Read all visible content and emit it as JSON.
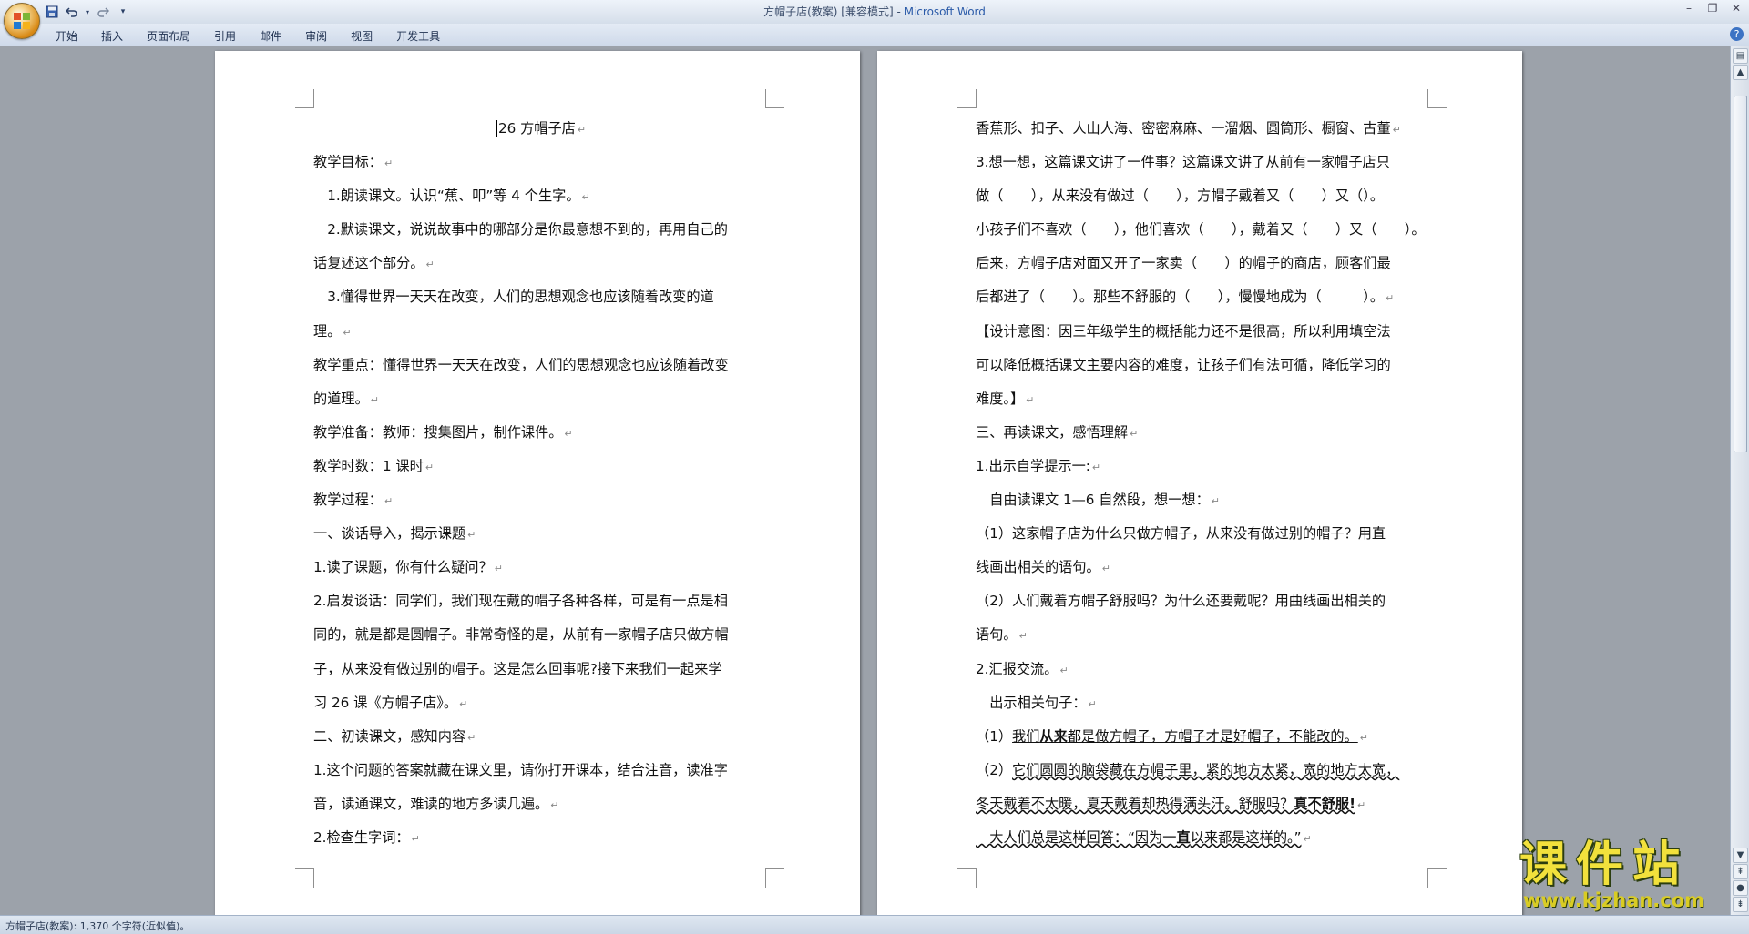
{
  "window": {
    "title_doc": "方帽子店(教案) [兼容模式] - ",
    "title_app": "Microsoft Word"
  },
  "qat": {
    "save_icon": "save-icon",
    "undo_icon": "undo-icon",
    "redo_icon": "redo-icon",
    "more_icon": "customize-icon"
  },
  "ribbon": {
    "tabs": [
      "开始",
      "插入",
      "页面布局",
      "引用",
      "邮件",
      "审阅",
      "视图",
      "开发工具"
    ]
  },
  "page1": {
    "lines": [
      "26 方帽子店",
      "教学目标：",
      "　1.朗读课文。认识“蕉、叩”等 4 个生字。",
      "　2.默读课文，说说故事中的哪部分是你最意想不到的，再用自己的",
      "话复述这个部分。",
      "　3.懂得世界一天天在改变，人们的思想观念也应该随着改变的道",
      "理。",
      "教学重点：懂得世界一天天在改变，人们的思想观念也应该随着改变",
      "的道理。",
      "教学准备：教师：搜集图片，制作课件。",
      "教学时数：1 课时",
      "教学过程：",
      "一、谈话导入，揭示课题",
      "1.读了课题，你有什么疑问？",
      "2.启发谈话：同学们，我们现在戴的帽子各种各样，可是有一点是相",
      "同的，就是都是圆帽子。非常奇怪的是，从前有一家帽子店只做方帽",
      "子，从来没有做过别的帽子。这是怎么回事呢?接下来我们一起来学",
      "习 26 课《方帽子店》。",
      "二、初读课文，感知内容",
      "1.这个问题的答案就藏在课文里，请你打开课本，结合注音，读准字",
      "音，读通课文，难读的地方多读几遍。",
      "2.检查生字词："
    ]
  },
  "page2": {
    "lines": [
      "香蕉形、扣子、人山人海、密密麻麻、一溜烟、圆筒形、橱窗、古董",
      "3.想一想，这篇课文讲了一件事？这篇课文讲了从前有一家帽子店只",
      "做（　　），从来没有做过（　　），方帽子戴着又（　　）又（）。",
      "小孩子们不喜欢（　　），他们喜欢（　　），戴着又（　　）又（　　）。",
      "后来，方帽子店对面又开了一家卖（　　）的帽子的商店，顾客们最",
      "后都进了（　　）。那些不舒服的（　　），慢慢地成为（　　　）。",
      "【设计意图：因三年级学生的概括能力还不是很高，所以利用填空法",
      "可以降低概括课文主要内容的难度，让孩子们有法可循，降低学习的",
      "难度。】",
      "三、再读课文，感悟理解",
      "1.出示自学提示一:",
      "　自由读课文 1—6 自然段，想一想：",
      "（1）这家帽子店为什么只做方帽子，从来没有做过别的帽子？用直",
      "线画出相关的语句。",
      "（2）人们戴着方帽子舒服吗？为什么还要戴呢？用曲线画出相关的",
      "语句。",
      "2.汇报交流。",
      "　出示相关句子："
    ],
    "q1_prefix": "（1）",
    "q1_a": "我们",
    "q1_bold": "从来",
    "q1_b": "都是做方帽子，方帽子才是好帽子，不能改的。",
    "q2_prefix": "（2）",
    "q2_a": "它们圆圆的脑袋藏在方帽子里，紧的地方太紧，宽的地方太宽，",
    "q2_b": "冬天戴着不太暖，夏天戴着却热得满头汗。舒服吗？",
    "q2_bold": "真不舒服!",
    "q3_a": "　大人们总是这样回答：“因为一",
    "q3_bold": "直",
    "q3_b": "以来都是这样的。”"
  },
  "status": {
    "text": "方帽子店(教案): 1,370 个字符(近似值)。"
  },
  "watermark": {
    "big": "课件站",
    "url": "www.kjzhan.com"
  }
}
